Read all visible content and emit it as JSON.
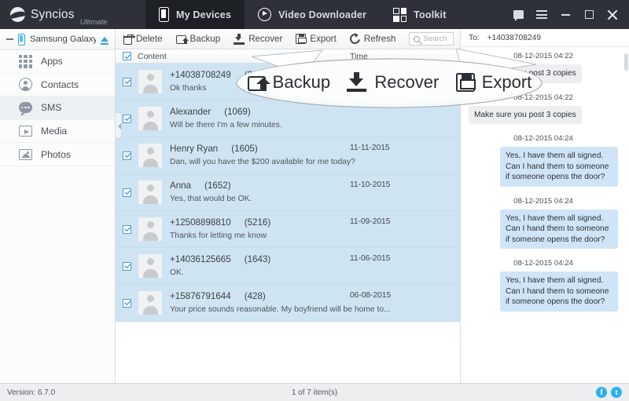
{
  "titlebar": {
    "brand_name": "Syncios",
    "brand_edition": "Ultimate",
    "tabs": [
      {
        "label": "My Devices",
        "icon": "phone-icon",
        "active": true
      },
      {
        "label": "Video Downloader",
        "icon": "play-circle-icon",
        "active": false
      },
      {
        "label": "Toolkit",
        "icon": "grid-four-icon",
        "active": false
      }
    ],
    "window_controls": [
      "feedback-icon",
      "menu-icon",
      "minimize-icon",
      "maximize-icon",
      "close-icon"
    ]
  },
  "sidebar": {
    "device": {
      "name": "Samsung Galaxy ...",
      "collapse_icon": "minus-icon",
      "eject_icon": "eject-icon"
    },
    "items": [
      {
        "label": "Apps",
        "icon": "apps-grid-icon",
        "active": false
      },
      {
        "label": "Contacts",
        "icon": "contacts-person-icon",
        "active": false
      },
      {
        "label": "SMS",
        "icon": "sms-bubble-icon",
        "active": true
      },
      {
        "label": "Media",
        "icon": "media-play-icon",
        "active": false
      },
      {
        "label": "Photos",
        "icon": "photos-image-icon",
        "active": false
      }
    ]
  },
  "toolbar": {
    "buttons": [
      {
        "label": "Delete",
        "icon": "trash-icon"
      },
      {
        "label": "Backup",
        "icon": "backup-icon"
      },
      {
        "label": "Recover",
        "icon": "recover-download-icon"
      },
      {
        "label": "Export",
        "icon": "export-save-icon"
      },
      {
        "label": "Refresh",
        "icon": "refresh-icon"
      }
    ],
    "search_placeholder": "Search"
  },
  "list": {
    "columns": {
      "content": "Content",
      "time": "Time"
    },
    "select_all_checked": true,
    "rows": [
      {
        "name": "+14038708249",
        "count": "(317)",
        "preview": "Ok thanks",
        "date": "",
        "checked": true
      },
      {
        "name": "Alexander",
        "count": "(1069)",
        "preview": "Will be there I'm a few minutes.",
        "date": "",
        "checked": true
      },
      {
        "name": "Henry Ryan",
        "count": "(1605)",
        "preview": "Dan, will you have the $200 available for me today?",
        "date": "11-11-2015",
        "checked": true
      },
      {
        "name": "Anna",
        "count": "(1652)",
        "preview": "Yes, that would be OK.",
        "date": "11-10-2015",
        "checked": true
      },
      {
        "name": "+12508898810",
        "count": "(5216)",
        "preview": "Thanks for letting me know",
        "date": "11-09-2015",
        "checked": true
      },
      {
        "name": "+14036125665",
        "count": "(1643)",
        "preview": "OK.",
        "date": "11-06-2015",
        "checked": true
      },
      {
        "name": "+15876791644",
        "count": "(428)",
        "preview": "Your price sounds reasonable. My boyfriend will be home to...",
        "date": "06-08-2015",
        "checked": true
      }
    ]
  },
  "conversation": {
    "to_label": "To:",
    "to_value": "+14038708249",
    "messages": [
      {
        "time": "08-12-2015 04:22",
        "text": "Make sure you post 3 copies",
        "direction": "in"
      },
      {
        "time": "08-12-2015 04:22",
        "text": "Make sure you post 3 copies",
        "direction": "in"
      },
      {
        "time": "08-12-2015 04:24",
        "text": "Yes, I have them all signed. Can I hand them to someone if someone opens the door?",
        "direction": "out"
      },
      {
        "time": "08-12-2015 04:24",
        "text": "Yes, I have them all signed. Can I hand them to someone if someone opens the door?",
        "direction": "out"
      },
      {
        "time": "08-12-2015 04:24",
        "text": "Yes, I have them all signed. Can I hand them to someone if someone opens the door?",
        "direction": "out"
      }
    ]
  },
  "callout": {
    "buttons": [
      {
        "label": "Backup",
        "icon": "backup-icon"
      },
      {
        "label": "Recover",
        "icon": "recover-download-icon"
      },
      {
        "label": "Export",
        "icon": "export-save-icon"
      }
    ]
  },
  "statusbar": {
    "version": "Version: 6.7.0",
    "item_count": "1 of 7 item(s)",
    "social": [
      {
        "label": "f",
        "name": "facebook-icon"
      },
      {
        "label": "t",
        "name": "twitter-icon"
      }
    ]
  },
  "colors": {
    "titlebar_bg": "#2e3238",
    "active_tab_bg": "#1d2025",
    "list_selection": "#cfe4f2",
    "bubble_out": "#cfe4f7",
    "bubble_in": "#eceef0",
    "accent": "#29b2ef"
  }
}
